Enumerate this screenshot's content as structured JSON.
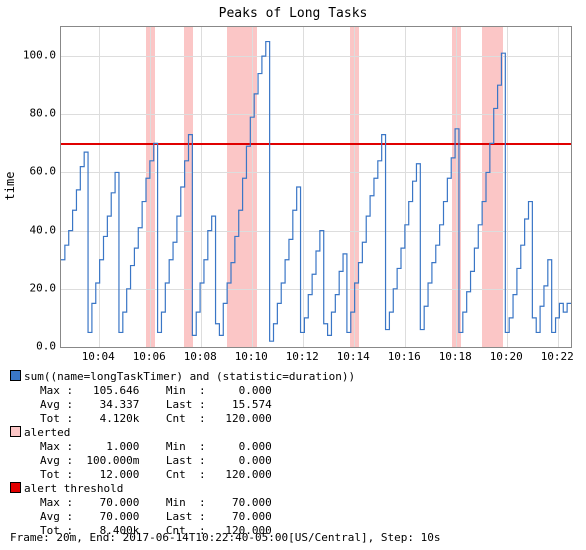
{
  "chart_data": {
    "type": "line",
    "title": "Peaks of Long Tasks",
    "ylabel": "time",
    "ylim": [
      0,
      110
    ],
    "xlim_minutes": [
      2.5,
      22.5
    ],
    "x_ticks": [
      "10:04",
      "10:06",
      "10:08",
      "10:10",
      "10:12",
      "10:14",
      "10:16",
      "10:18",
      "10:20",
      "10:22"
    ],
    "y_ticks": [
      0,
      20,
      40,
      60,
      80,
      100
    ],
    "threshold": 70,
    "series": [
      {
        "name": "sum((name=longTaskTimer) and (statistic=duration))",
        "values": [
          30,
          35,
          40,
          47,
          54,
          62,
          67,
          5,
          15,
          22,
          30,
          38,
          45,
          53,
          60,
          5,
          12,
          20,
          28,
          34,
          41,
          50,
          58,
          64,
          70,
          5,
          12,
          22,
          30,
          36,
          45,
          55,
          64,
          73,
          4,
          12,
          22,
          30,
          40,
          45,
          8,
          4,
          15,
          22,
          29,
          38,
          47,
          58,
          69,
          79,
          87,
          94,
          100,
          105,
          2,
          8,
          15,
          22,
          30,
          37,
          47,
          55,
          5,
          10,
          18,
          25,
          33,
          40,
          8,
          4,
          12,
          18,
          26,
          32,
          5,
          12,
          22,
          29,
          36,
          45,
          52,
          58,
          64,
          73,
          6,
          12,
          20,
          27,
          34,
          42,
          50,
          57,
          63,
          6,
          14,
          22,
          29,
          35,
          42,
          50,
          58,
          65,
          75,
          5,
          12,
          19,
          26,
          34,
          42,
          50,
          60,
          70,
          82,
          90,
          101,
          5,
          10,
          18,
          27,
          35,
          44,
          50,
          10,
          5,
          14,
          21,
          30,
          5,
          10,
          15,
          12,
          15
        ]
      }
    ],
    "alert_bands_x": [
      [
        5.83,
        6.17
      ],
      [
        7.33,
        7.67
      ],
      [
        9.0,
        10.17
      ],
      [
        13.83,
        14.17
      ],
      [
        17.83,
        18.17
      ],
      [
        19.0,
        19.83
      ]
    ]
  },
  "legend": [
    {
      "color": "blue",
      "label": "sum((name=longTaskTimer) and (statistic=duration))",
      "stats": {
        "Max": "105.646",
        "Min": "0.000",
        "Avg": "34.337",
        "Last": "15.574",
        "Tot": "4.120k",
        "Cnt": "120.000"
      }
    },
    {
      "color": "pink",
      "label": "alerted",
      "stats": {
        "Max": "1.000",
        "Min": "0.000",
        "Avg": "100.000m",
        "Last": "0.000",
        "Tot": "12.000",
        "Cnt": "120.000"
      }
    },
    {
      "color": "red",
      "label": "alert threshold",
      "stats": {
        "Max": "70.000",
        "Min": "70.000",
        "Avg": "70.000",
        "Last": "70.000",
        "Tot": "8.400k",
        "Cnt": "120.000"
      }
    }
  ],
  "footer": "Frame: 20m, End: 2017-06-14T10:22:40-05:00[US/Central], Step: 10s"
}
